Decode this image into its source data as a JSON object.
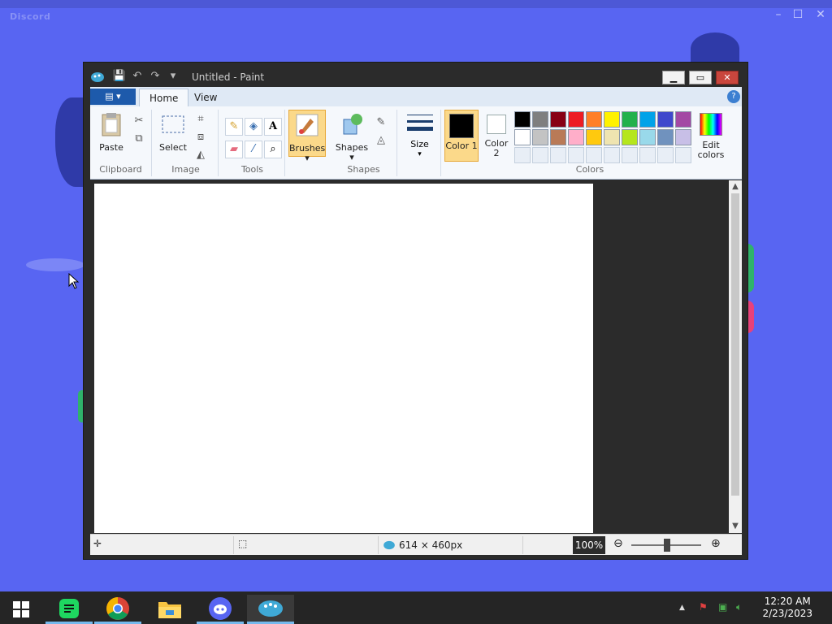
{
  "discord": {
    "brand": "Discord",
    "minimize": "–",
    "maximize": "☐",
    "close": "✕"
  },
  "paint": {
    "title": "Untitled - Paint",
    "quick_access": [
      "💾",
      "↶",
      "↷",
      "▾"
    ],
    "window_buttons": {
      "minimize": "▁",
      "maximize": "▭",
      "close": "✕"
    },
    "file_tab": "▤ ▾",
    "tabs": [
      {
        "label": "Home"
      },
      {
        "label": "View"
      }
    ],
    "help": "?",
    "groups": {
      "clipboard": {
        "label": "Clipboard",
        "paste": "Paste"
      },
      "image": {
        "label": "Image",
        "select": "Select"
      },
      "tools": {
        "label": "Tools"
      },
      "brushes": {
        "label": "Brushes"
      },
      "shapes": {
        "label": "Shapes",
        "shapes_btn": "Shapes"
      },
      "size": {
        "label": "Size"
      },
      "colors": {
        "label": "Colors",
        "color1": "Color 1",
        "color2": "Color 2",
        "edit": "Edit colors",
        "color1_value": "#000000",
        "color2_value": "#ffffff",
        "row1": [
          "#000000",
          "#7f7f7f",
          "#880015",
          "#ed1c24",
          "#ff7f27",
          "#fff200",
          "#22b14c",
          "#00a2e8",
          "#3f48cc",
          "#a349a4"
        ],
        "row2": [
          "#ffffff",
          "#c3c3c3",
          "#b97a57",
          "#ffaec9",
          "#ffc90e",
          "#efe4b0",
          "#b5e61d",
          "#99d9ea",
          "#7092be",
          "#c8bfe7"
        ]
      }
    },
    "status": {
      "dimensions": "614 × 460px",
      "zoom": "100%"
    }
  },
  "taskbar": {
    "time": "12:20 AM",
    "date": "2/23/2023"
  }
}
